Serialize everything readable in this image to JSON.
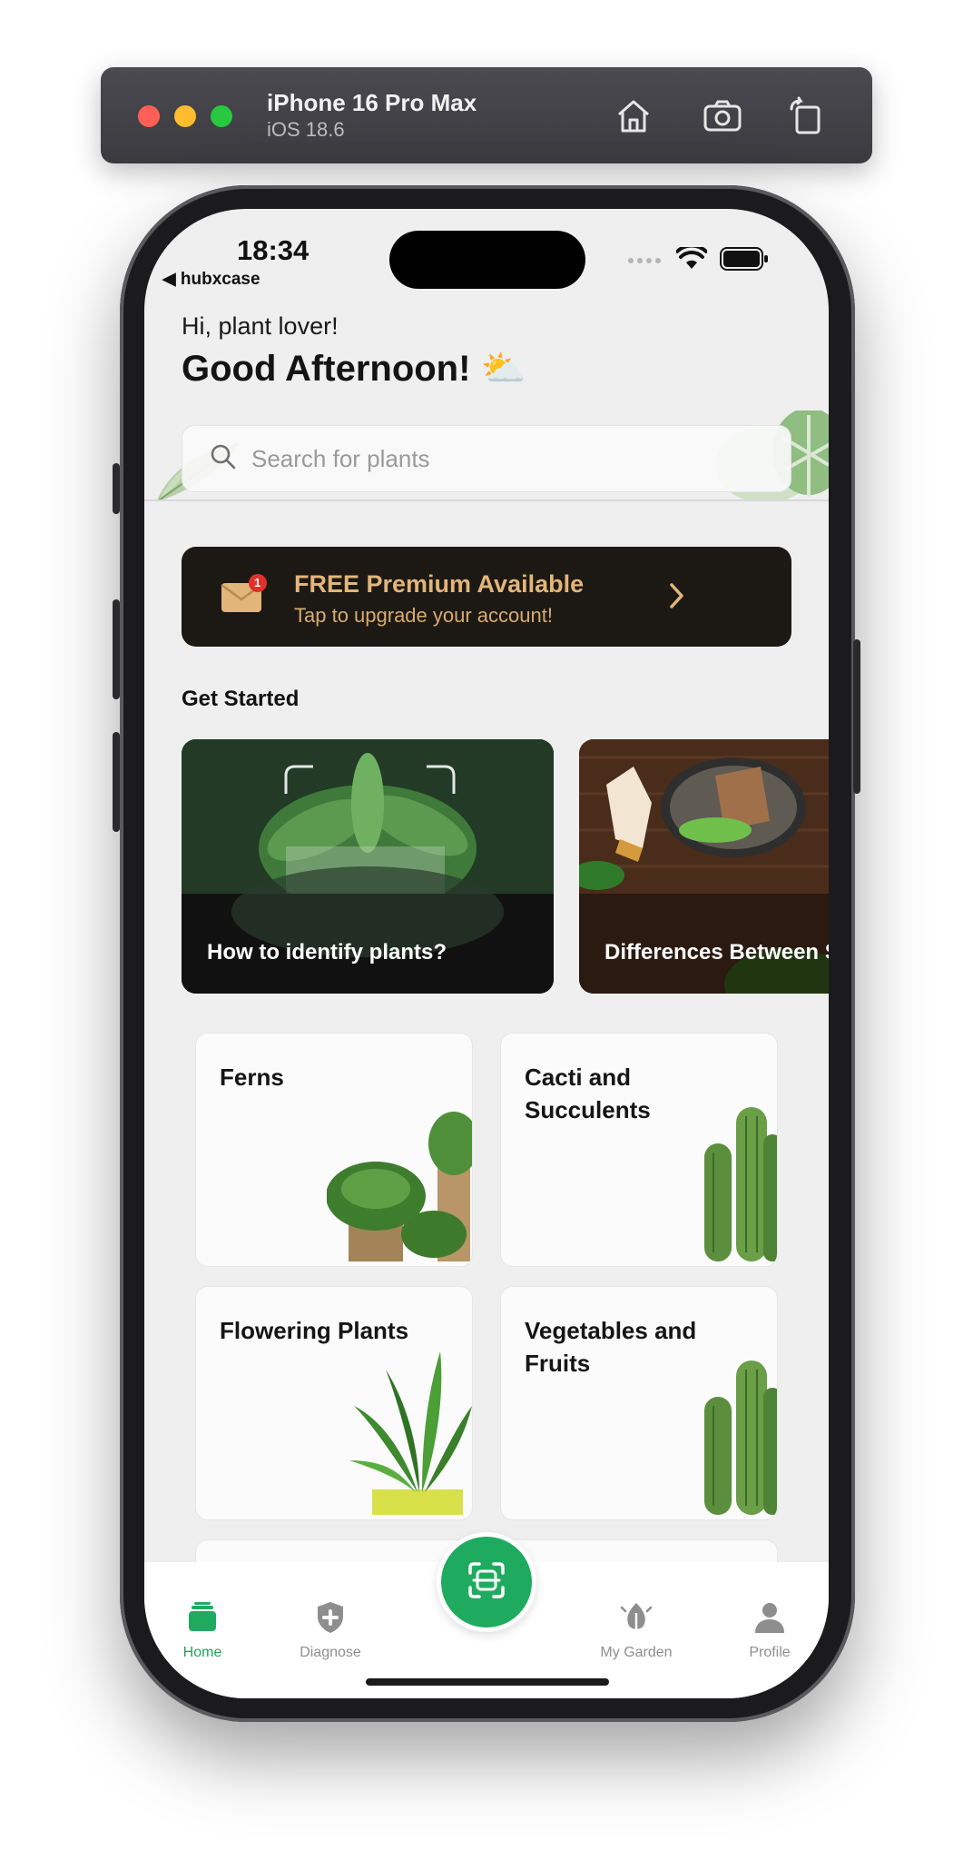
{
  "simulator": {
    "device_name": "iPhone 16 Pro Max",
    "os_version": "iOS 18.6",
    "buttons": [
      "home-icon",
      "screenshot-icon",
      "rotate-icon"
    ]
  },
  "status_bar": {
    "time": "18:34",
    "back_label": "◀ hubxcase"
  },
  "header": {
    "greeting": "Hi, plant lover!",
    "headline": "Good Afternoon! ⛅"
  },
  "search": {
    "placeholder": "Search for plants"
  },
  "premium": {
    "badge_count": "1",
    "title": "FREE Premium Available",
    "subtitle": "Tap to upgrade your account!",
    "accent": "#e2b57a"
  },
  "get_started": {
    "title": "Get Started",
    "cards": [
      {
        "label": "How to identify plants?"
      },
      {
        "label": "Differences Between Species and Varieties?"
      }
    ]
  },
  "categories": [
    {
      "label": "Ferns"
    },
    {
      "label": "Cacti and Succulents"
    },
    {
      "label": "Flowering Plants"
    },
    {
      "label": "Vegetables and Fruits"
    }
  ],
  "tabbar": {
    "accent": "#1fab5f",
    "tabs": [
      {
        "label": "Home",
        "icon": "home-icon",
        "active": true
      },
      {
        "label": "Diagnose",
        "icon": "shield-plus-icon",
        "active": false
      },
      {
        "label": "My Garden",
        "icon": "leaf-icon",
        "active": false
      },
      {
        "label": "Profile",
        "icon": "person-icon",
        "active": false
      }
    ],
    "center_action_icon": "scan-icon"
  }
}
